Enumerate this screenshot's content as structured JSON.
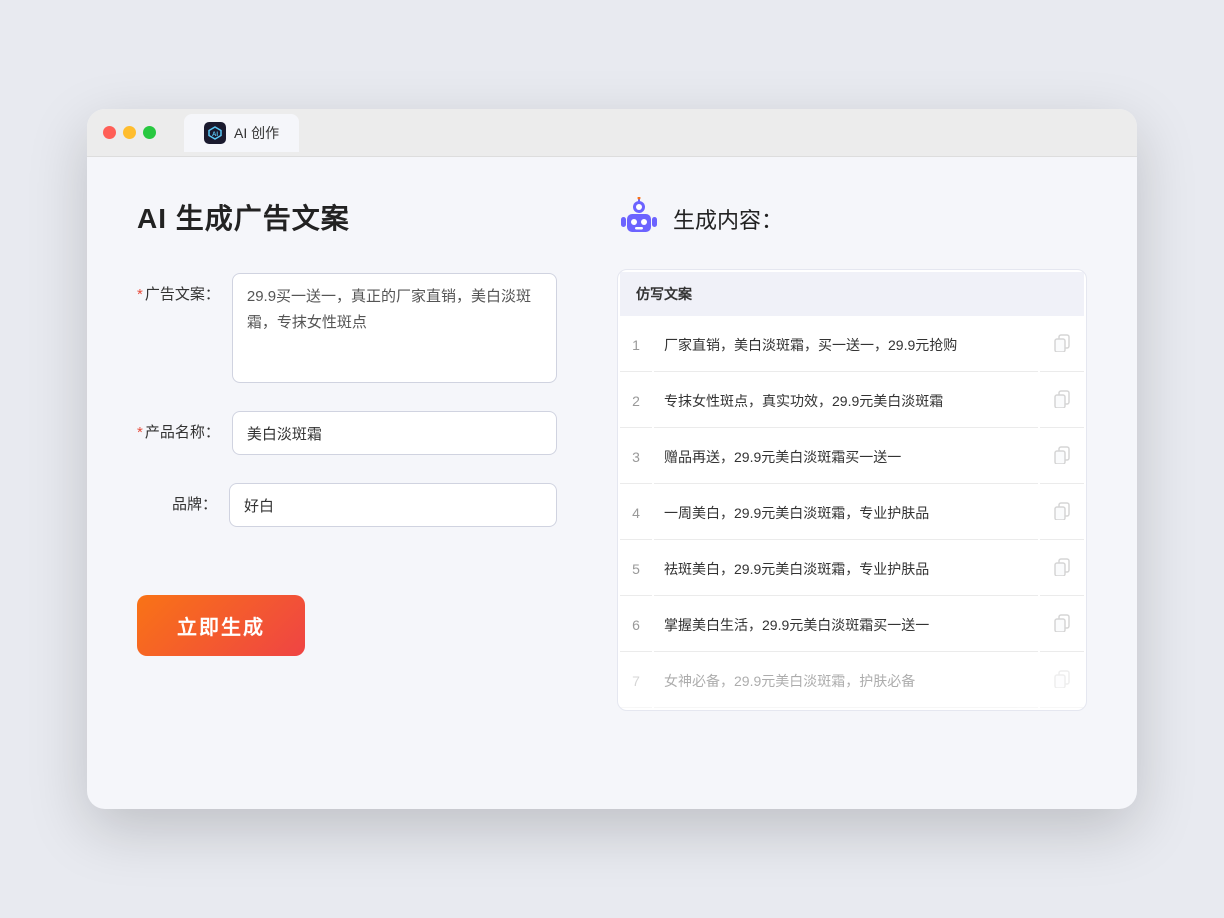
{
  "browser": {
    "tab_label": "AI 创作",
    "tab_icon": "AI"
  },
  "page": {
    "title": "AI 生成广告文案"
  },
  "form": {
    "ad_copy_label": "广告文案：",
    "ad_copy_required": "*",
    "ad_copy_value": "29.9买一送一，真正的厂家直销，美白淡斑霜，专抹女性斑点",
    "product_name_label": "产品名称：",
    "product_name_required": "*",
    "product_name_value": "美白淡斑霜",
    "brand_label": "品牌：",
    "brand_value": "好白",
    "generate_button": "立即生成"
  },
  "result": {
    "header_icon": "robot",
    "header_title": "生成内容：",
    "column_header": "仿写文案",
    "items": [
      {
        "num": "1",
        "text": "厂家直销，美白淡斑霜，买一送一，29.9元抢购",
        "faded": false
      },
      {
        "num": "2",
        "text": "专抹女性斑点，真实功效，29.9元美白淡斑霜",
        "faded": false
      },
      {
        "num": "3",
        "text": "赠品再送，29.9元美白淡斑霜买一送一",
        "faded": false
      },
      {
        "num": "4",
        "text": "一周美白，29.9元美白淡斑霜，专业护肤品",
        "faded": false
      },
      {
        "num": "5",
        "text": "祛斑美白，29.9元美白淡斑霜，专业护肤品",
        "faded": false
      },
      {
        "num": "6",
        "text": "掌握美白生活，29.9元美白淡斑霜买一送一",
        "faded": false
      },
      {
        "num": "7",
        "text": "女神必备，29.9元美白淡斑霜，护肤必备",
        "faded": true
      }
    ]
  }
}
